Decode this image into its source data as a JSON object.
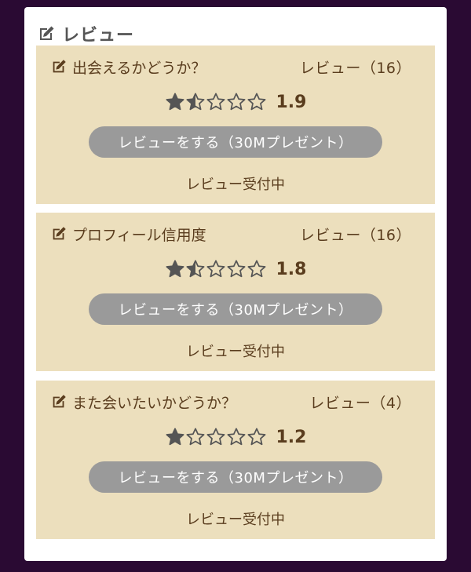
{
  "section": {
    "title": "レビュー",
    "icon": "edit-icon"
  },
  "colors": {
    "background": "#2a0a33",
    "card": "#ecdfbd",
    "text": "#5a3d1e",
    "button": "#9a9a9a",
    "star": "#555555"
  },
  "cards": [
    {
      "title": "出会えるかどうか？",
      "review_count": "レビュー（16）",
      "rating": 1.5,
      "score": "1.9",
      "button_label": "レビューをする（30Mプレゼント）",
      "status": "レビュー受付中"
    },
    {
      "title": "プロフィール信用度",
      "review_count": "レビュー（16）",
      "rating": 1.5,
      "score": "1.8",
      "button_label": "レビューをする（30Mプレゼント）",
      "status": "レビュー受付中"
    },
    {
      "title": "また会いたいかどうか？",
      "review_count": "レビュー（4）",
      "rating": 1,
      "score": "1.2",
      "button_label": "レビューをする（30Mプレゼント）",
      "status": "レビュー受付中"
    }
  ]
}
